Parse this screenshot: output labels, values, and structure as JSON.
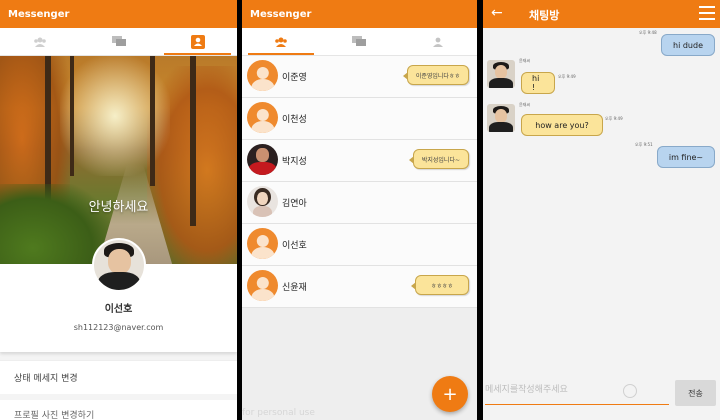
{
  "colors": {
    "primary": "#ef7b13",
    "myBubble": "#b8d4ef",
    "otherBubble": "#fbe49a"
  },
  "panel1": {
    "app_title": "Messenger",
    "tabs": [
      {
        "icon": "people-icon"
      },
      {
        "icon": "chat-icon"
      },
      {
        "icon": "person-icon",
        "active": true
      }
    ],
    "greeting": "안녕하세요",
    "name": "이선호",
    "email": "sh112123@naver.com",
    "menu": [
      "상태 메세지 변경",
      "프로필 사진 변경하기"
    ]
  },
  "panel2": {
    "app_title": "Messenger",
    "friends": [
      {
        "name": "이준영",
        "status": "이준영입니다ㅎㅎ",
        "avatar": "default"
      },
      {
        "name": "이천성",
        "status": "",
        "avatar": "default"
      },
      {
        "name": "박지성",
        "status": "박지성입니다~",
        "avatar": "photo-red"
      },
      {
        "name": "김연아",
        "status": "",
        "avatar": "photo-girl"
      },
      {
        "name": "이선호",
        "status": "",
        "avatar": "default"
      },
      {
        "name": "신윤재",
        "status": "ㅎㅎㅎㅎ",
        "avatar": "default"
      }
    ],
    "fab_label": "+",
    "watermark": "for personal use"
  },
  "panel3": {
    "title": "채팅방",
    "messages": [
      {
        "from": "me",
        "text": "hi dude",
        "meta": "오후 9:48"
      },
      {
        "from": "other",
        "sender": "윤재씨",
        "text": "hi !",
        "meta": "오후 9:49"
      },
      {
        "from": "other",
        "sender": "윤재씨",
        "text": "how are you?",
        "meta": "오후 9:49"
      },
      {
        "from": "me",
        "text": "im fine~",
        "meta": "오후 9:51"
      }
    ],
    "input_placeholder": "메세지를작성해주세요",
    "send_label": "전송"
  }
}
